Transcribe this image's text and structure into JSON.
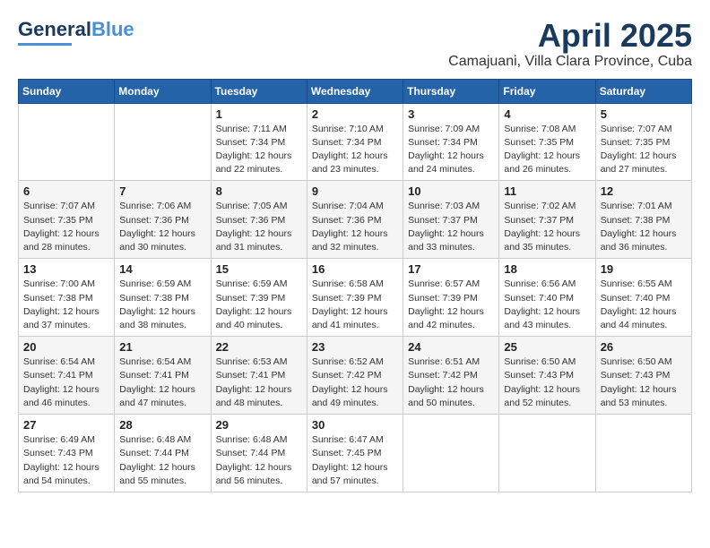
{
  "logo": {
    "general": "General",
    "blue": "Blue"
  },
  "header": {
    "month_year": "April 2025",
    "location": "Camajuani, Villa Clara Province, Cuba"
  },
  "weekdays": [
    "Sunday",
    "Monday",
    "Tuesday",
    "Wednesday",
    "Thursday",
    "Friday",
    "Saturday"
  ],
  "weeks": [
    [
      {
        "day": "",
        "info": ""
      },
      {
        "day": "",
        "info": ""
      },
      {
        "day": "1",
        "info": "Sunrise: 7:11 AM\nSunset: 7:34 PM\nDaylight: 12 hours and 22 minutes."
      },
      {
        "day": "2",
        "info": "Sunrise: 7:10 AM\nSunset: 7:34 PM\nDaylight: 12 hours and 23 minutes."
      },
      {
        "day": "3",
        "info": "Sunrise: 7:09 AM\nSunset: 7:34 PM\nDaylight: 12 hours and 24 minutes."
      },
      {
        "day": "4",
        "info": "Sunrise: 7:08 AM\nSunset: 7:35 PM\nDaylight: 12 hours and 26 minutes."
      },
      {
        "day": "5",
        "info": "Sunrise: 7:07 AM\nSunset: 7:35 PM\nDaylight: 12 hours and 27 minutes."
      }
    ],
    [
      {
        "day": "6",
        "info": "Sunrise: 7:07 AM\nSunset: 7:35 PM\nDaylight: 12 hours and 28 minutes."
      },
      {
        "day": "7",
        "info": "Sunrise: 7:06 AM\nSunset: 7:36 PM\nDaylight: 12 hours and 30 minutes."
      },
      {
        "day": "8",
        "info": "Sunrise: 7:05 AM\nSunset: 7:36 PM\nDaylight: 12 hours and 31 minutes."
      },
      {
        "day": "9",
        "info": "Sunrise: 7:04 AM\nSunset: 7:36 PM\nDaylight: 12 hours and 32 minutes."
      },
      {
        "day": "10",
        "info": "Sunrise: 7:03 AM\nSunset: 7:37 PM\nDaylight: 12 hours and 33 minutes."
      },
      {
        "day": "11",
        "info": "Sunrise: 7:02 AM\nSunset: 7:37 PM\nDaylight: 12 hours and 35 minutes."
      },
      {
        "day": "12",
        "info": "Sunrise: 7:01 AM\nSunset: 7:38 PM\nDaylight: 12 hours and 36 minutes."
      }
    ],
    [
      {
        "day": "13",
        "info": "Sunrise: 7:00 AM\nSunset: 7:38 PM\nDaylight: 12 hours and 37 minutes."
      },
      {
        "day": "14",
        "info": "Sunrise: 6:59 AM\nSunset: 7:38 PM\nDaylight: 12 hours and 38 minutes."
      },
      {
        "day": "15",
        "info": "Sunrise: 6:59 AM\nSunset: 7:39 PM\nDaylight: 12 hours and 40 minutes."
      },
      {
        "day": "16",
        "info": "Sunrise: 6:58 AM\nSunset: 7:39 PM\nDaylight: 12 hours and 41 minutes."
      },
      {
        "day": "17",
        "info": "Sunrise: 6:57 AM\nSunset: 7:39 PM\nDaylight: 12 hours and 42 minutes."
      },
      {
        "day": "18",
        "info": "Sunrise: 6:56 AM\nSunset: 7:40 PM\nDaylight: 12 hours and 43 minutes."
      },
      {
        "day": "19",
        "info": "Sunrise: 6:55 AM\nSunset: 7:40 PM\nDaylight: 12 hours and 44 minutes."
      }
    ],
    [
      {
        "day": "20",
        "info": "Sunrise: 6:54 AM\nSunset: 7:41 PM\nDaylight: 12 hours and 46 minutes."
      },
      {
        "day": "21",
        "info": "Sunrise: 6:54 AM\nSunset: 7:41 PM\nDaylight: 12 hours and 47 minutes."
      },
      {
        "day": "22",
        "info": "Sunrise: 6:53 AM\nSunset: 7:41 PM\nDaylight: 12 hours and 48 minutes."
      },
      {
        "day": "23",
        "info": "Sunrise: 6:52 AM\nSunset: 7:42 PM\nDaylight: 12 hours and 49 minutes."
      },
      {
        "day": "24",
        "info": "Sunrise: 6:51 AM\nSunset: 7:42 PM\nDaylight: 12 hours and 50 minutes."
      },
      {
        "day": "25",
        "info": "Sunrise: 6:50 AM\nSunset: 7:43 PM\nDaylight: 12 hours and 52 minutes."
      },
      {
        "day": "26",
        "info": "Sunrise: 6:50 AM\nSunset: 7:43 PM\nDaylight: 12 hours and 53 minutes."
      }
    ],
    [
      {
        "day": "27",
        "info": "Sunrise: 6:49 AM\nSunset: 7:43 PM\nDaylight: 12 hours and 54 minutes."
      },
      {
        "day": "28",
        "info": "Sunrise: 6:48 AM\nSunset: 7:44 PM\nDaylight: 12 hours and 55 minutes."
      },
      {
        "day": "29",
        "info": "Sunrise: 6:48 AM\nSunset: 7:44 PM\nDaylight: 12 hours and 56 minutes."
      },
      {
        "day": "30",
        "info": "Sunrise: 6:47 AM\nSunset: 7:45 PM\nDaylight: 12 hours and 57 minutes."
      },
      {
        "day": "",
        "info": ""
      },
      {
        "day": "",
        "info": ""
      },
      {
        "day": "",
        "info": ""
      }
    ]
  ]
}
